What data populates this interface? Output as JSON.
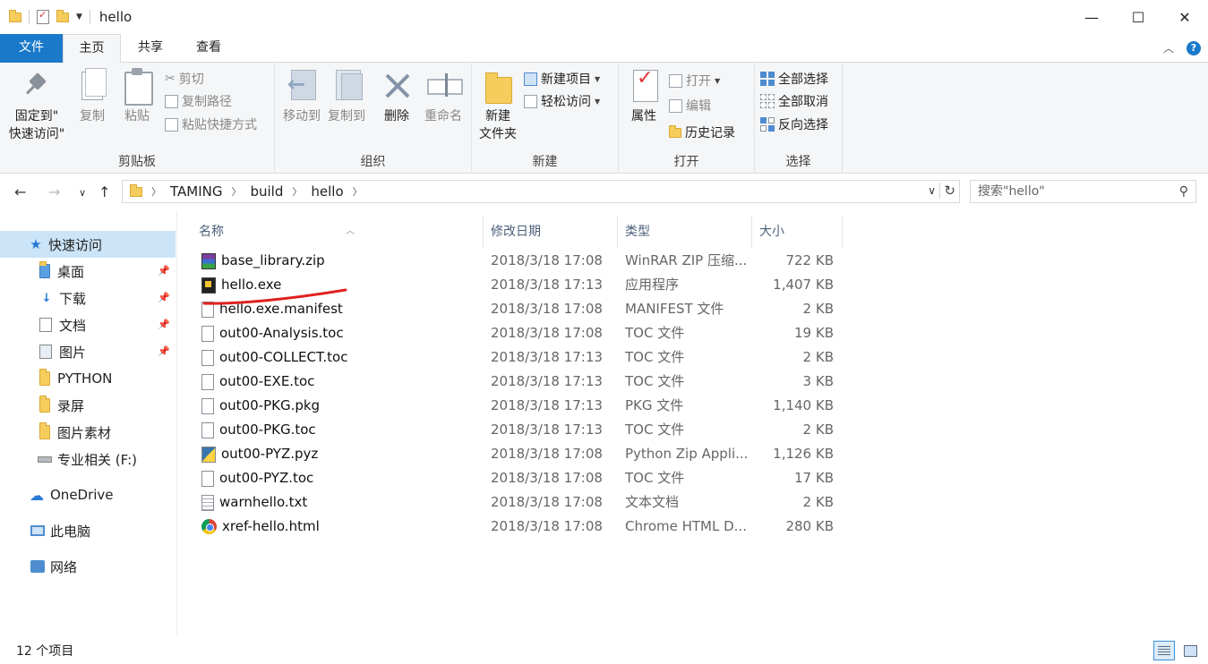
{
  "window": {
    "title": "hello",
    "controls": {
      "minimize": "—",
      "maximize": "☐",
      "close": "✕"
    }
  },
  "ribbon_tabs": {
    "file": "文件",
    "home": "主页",
    "share": "共享",
    "view": "查看"
  },
  "ribbon": {
    "clipboard": {
      "label": "剪贴板",
      "pin_line1": "固定到\"",
      "pin_line2": "快速访问\"",
      "copy": "复制",
      "paste": "粘贴",
      "cut": "剪切",
      "copy_path": "复制路径",
      "paste_shortcut": "粘贴快捷方式"
    },
    "organize": {
      "label": "组织",
      "move_to": "移动到",
      "copy_to": "复制到",
      "delete": "删除",
      "rename": "重命名"
    },
    "new": {
      "label": "新建",
      "new_folder_line1": "新建",
      "new_folder_line2": "文件夹",
      "new_item": "新建项目",
      "easy_access": "轻松访问"
    },
    "open": {
      "label": "打开",
      "properties": "属性",
      "open": "打开",
      "edit": "编辑",
      "history": "历史记录"
    },
    "select": {
      "label": "选择",
      "select_all": "全部选择",
      "select_none": "全部取消",
      "invert": "反向选择"
    }
  },
  "address": {
    "crumbs": [
      "TAMING",
      "build",
      "hello"
    ],
    "search_placeholder": "搜索\"hello\""
  },
  "nav": {
    "quick_access": "快速访问",
    "items": [
      {
        "label": "桌面",
        "pinned": true
      },
      {
        "label": "下载",
        "pinned": true
      },
      {
        "label": "文档",
        "pinned": true
      },
      {
        "label": "图片",
        "pinned": true
      },
      {
        "label": "PYTHON",
        "pinned": false
      },
      {
        "label": "录屏",
        "pinned": false
      },
      {
        "label": "图片素材",
        "pinned": false
      },
      {
        "label": "专业相关 (F:)",
        "pinned": false
      }
    ],
    "onedrive": "OneDrive",
    "this_pc": "此电脑",
    "network": "网络"
  },
  "columns": {
    "name": "名称",
    "date": "修改日期",
    "type": "类型",
    "size": "大小"
  },
  "files": [
    {
      "name": "base_library.zip",
      "date": "2018/3/18 17:08",
      "type": "WinRAR ZIP 压缩...",
      "size": "722 KB",
      "icon": "winrar-icon"
    },
    {
      "name": "hello.exe",
      "date": "2018/3/18 17:13",
      "type": "应用程序",
      "size": "1,407 KB",
      "icon": "exe-icon"
    },
    {
      "name": "hello.exe.manifest",
      "date": "2018/3/18 17:08",
      "type": "MANIFEST 文件",
      "size": "2 KB",
      "icon": "file-icon"
    },
    {
      "name": "out00-Analysis.toc",
      "date": "2018/3/18 17:08",
      "type": "TOC 文件",
      "size": "19 KB",
      "icon": "file-icon"
    },
    {
      "name": "out00-COLLECT.toc",
      "date": "2018/3/18 17:13",
      "type": "TOC 文件",
      "size": "2 KB",
      "icon": "file-icon"
    },
    {
      "name": "out00-EXE.toc",
      "date": "2018/3/18 17:13",
      "type": "TOC 文件",
      "size": "3 KB",
      "icon": "file-icon"
    },
    {
      "name": "out00-PKG.pkg",
      "date": "2018/3/18 17:13",
      "type": "PKG 文件",
      "size": "1,140 KB",
      "icon": "file-icon"
    },
    {
      "name": "out00-PKG.toc",
      "date": "2018/3/18 17:13",
      "type": "TOC 文件",
      "size": "2 KB",
      "icon": "file-icon"
    },
    {
      "name": "out00-PYZ.pyz",
      "date": "2018/3/18 17:08",
      "type": "Python Zip Appli...",
      "size": "1,126 KB",
      "icon": "python-icon"
    },
    {
      "name": "out00-PYZ.toc",
      "date": "2018/3/18 17:08",
      "type": "TOC 文件",
      "size": "17 KB",
      "icon": "file-icon"
    },
    {
      "name": "warnhello.txt",
      "date": "2018/3/18 17:08",
      "type": "文本文档",
      "size": "2 KB",
      "icon": "text-file-icon"
    },
    {
      "name": "xref-hello.html",
      "date": "2018/3/18 17:08",
      "type": "Chrome HTML D...",
      "size": "280 KB",
      "icon": "chrome-icon"
    }
  ],
  "status": {
    "item_count": "12 个项目"
  },
  "colors": {
    "accent": "#1979ca",
    "selection": "#cce4f7",
    "annotation": "#e02020"
  }
}
